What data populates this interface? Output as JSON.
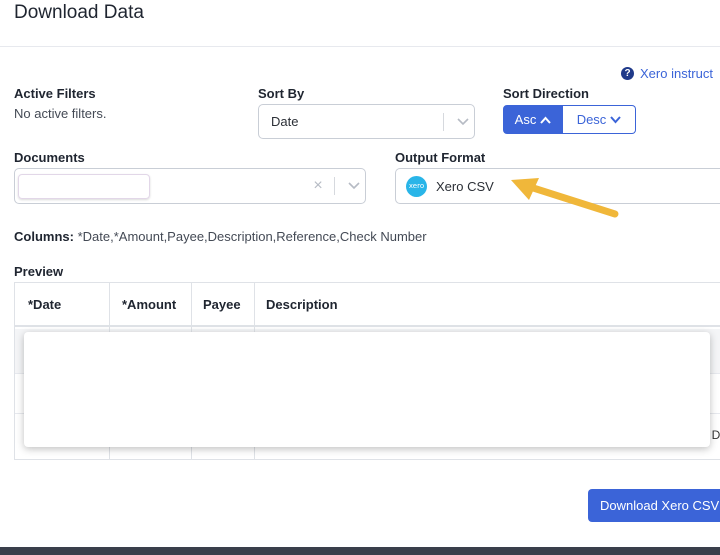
{
  "header": {
    "title": "Download Data"
  },
  "help_link": {
    "label": "Xero instruct"
  },
  "filters": {
    "label": "Active Filters",
    "value": "No active filters."
  },
  "sort_by": {
    "label": "Sort By",
    "value": "Date"
  },
  "sort_direction": {
    "label": "Sort Direction",
    "asc_label": "Asc",
    "desc_label": "Desc",
    "selected": "Asc"
  },
  "documents": {
    "label": "Documents",
    "clear_symbol": "×"
  },
  "output_format": {
    "label": "Output Format",
    "logo_text": "xero",
    "value": "Xero CSV"
  },
  "columns": {
    "label": "Columns:",
    "value": "*Date,*Amount,Payee,Description,Reference,Check Number"
  },
  "preview": {
    "label": "Preview",
    "headers": [
      "*Date",
      "*Amount",
      "Payee",
      "Description"
    ],
    "truncated_cell": "/ D"
  },
  "download_button": {
    "label": "Download Xero CSV"
  },
  "colors": {
    "accent": "#3b64d8",
    "arrow": "#f0b73a",
    "xero_blue": "#29b5e8"
  }
}
